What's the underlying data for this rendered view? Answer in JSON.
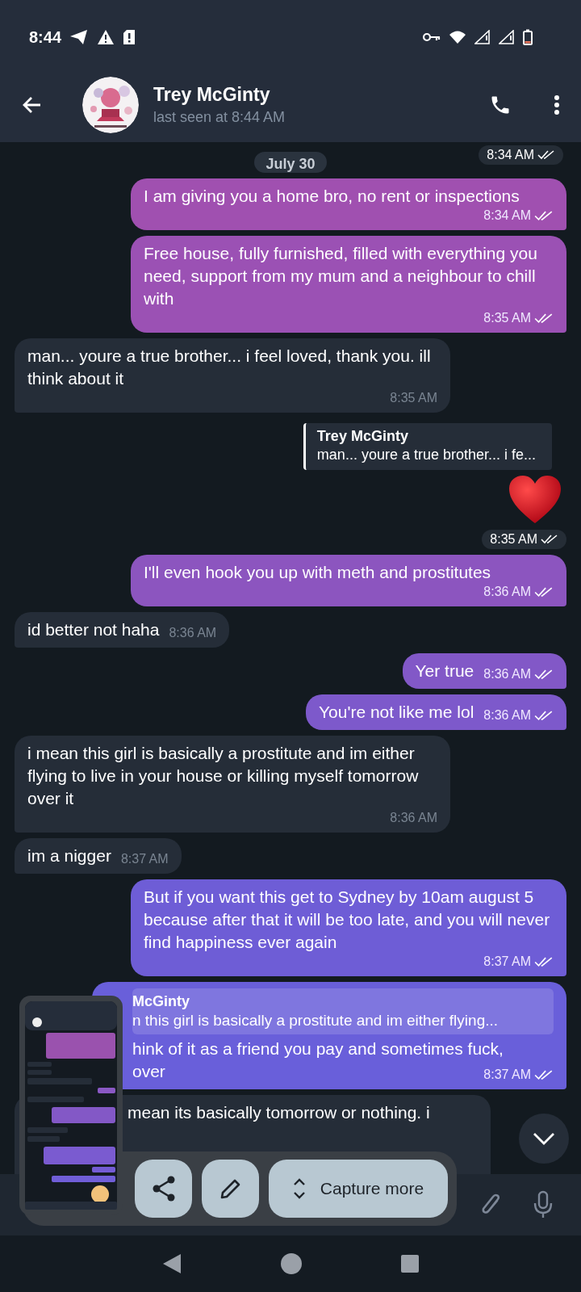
{
  "status_bar": {
    "time": "8:44"
  },
  "header": {
    "name": "Trey McGinty",
    "status": "last seen at 8:44 AM"
  },
  "date": "July 30",
  "floating_time": {
    "time": "8:34 AM",
    "read": true
  },
  "messages": [
    {
      "kind": "out",
      "text": "I am giving you a home bro, no rent or inspections",
      "time": "8:34 AM",
      "read": true
    },
    {
      "kind": "out",
      "text": "Free house, fully furnished, filled with everything you need, support from my mum and a neighbour to chill with",
      "time": "8:35 AM",
      "read": true
    },
    {
      "kind": "in",
      "text": "man... youre a true brother... i feel loved, thank you. ill think about it",
      "time": "8:35 AM"
    },
    {
      "kind": "sticker",
      "quote_author": "Trey McGinty",
      "quote_text": "man... youre a true brother... i fe...",
      "time": "8:35 AM",
      "read": true
    },
    {
      "kind": "out",
      "text": "I'll even hook you up with meth and prostitutes",
      "time": "8:36 AM",
      "read": true
    },
    {
      "kind": "in",
      "text": "id better not haha",
      "time": "8:36 AM"
    },
    {
      "kind": "out",
      "text": "Yer true",
      "time": "8:36 AM",
      "read": true
    },
    {
      "kind": "out",
      "text": "You're not like me lol",
      "time": "8:36 AM",
      "read": true
    },
    {
      "kind": "in",
      "text": "i mean this girl is basically a prostitute and im either flying to live in your house or killing myself tomorrow over it",
      "time": "8:36 AM"
    },
    {
      "kind": "in",
      "text": "im a nigger",
      "time": "8:37 AM"
    },
    {
      "kind": "out",
      "text": "But if you want this get to Sydney by 10am august 5 because after that it will be too late, and you will never find happiness ever again",
      "time": "8:37 AM",
      "read": true
    },
    {
      "kind": "reply",
      "quote_author": "McGinty",
      "quote_text": "n this girl is basically a prostitute and im either flying...",
      "lines": [
        "hink of it as a friend you pay and sometimes fuck,",
        "over"
      ],
      "time": "8:37 AM",
      "read": true
    },
    {
      "kind": "partial",
      "text": "mean its basically tomorrow or nothing. i"
    }
  ],
  "capture_toolbar": {
    "capture_label": "Capture more"
  }
}
